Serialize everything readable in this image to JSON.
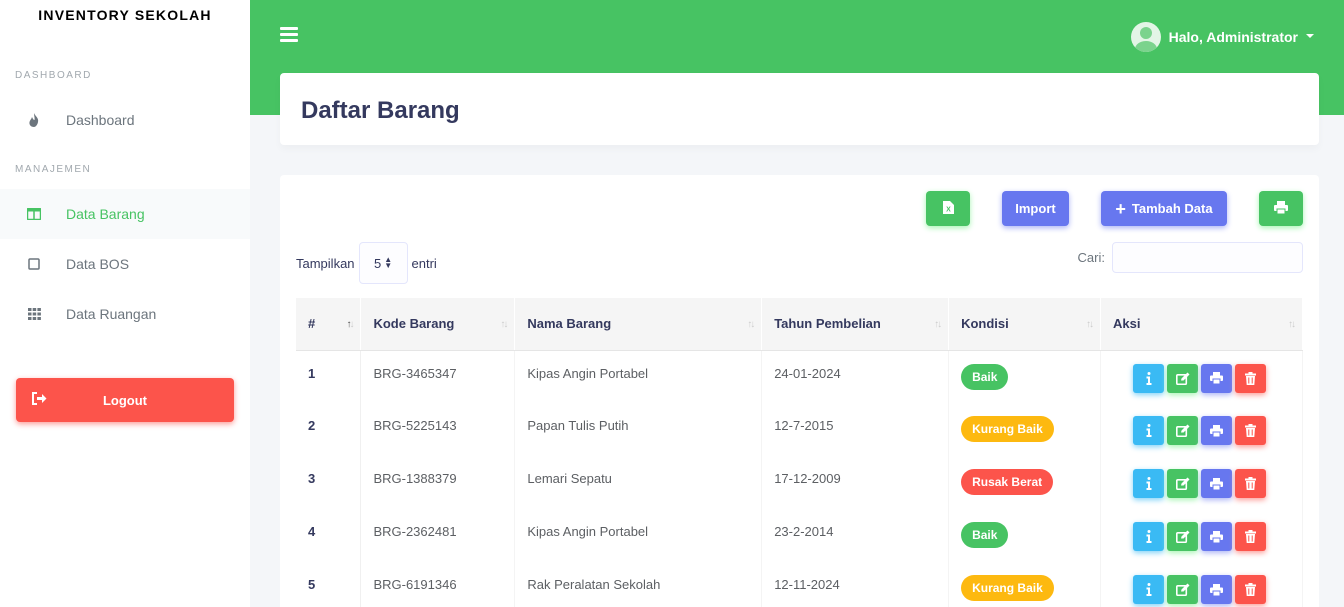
{
  "app": {
    "brand": "INVENTORY SEKOLAH"
  },
  "sidebar": {
    "headers": [
      "DASHBOARD",
      "MANAJEMEN"
    ],
    "items": [
      {
        "label": "Dashboard",
        "icon": "fire-icon",
        "active": false
      },
      {
        "label": "Data Barang",
        "icon": "columns-icon",
        "active": true
      },
      {
        "label": "Data BOS",
        "icon": "square-icon",
        "active": false
      },
      {
        "label": "Data Ruangan",
        "icon": "th-icon",
        "active": false
      }
    ],
    "logout_label": "Logout"
  },
  "topbar": {
    "greeting": "Halo, Administrator"
  },
  "page": {
    "title": "Daftar Barang"
  },
  "toolbar": {
    "import_label": "Import",
    "add_label": "Tambah Data"
  },
  "table_controls": {
    "show_prefix": "Tampilkan",
    "show_value": "5",
    "show_suffix": "entri",
    "search_label": "Cari:"
  },
  "table": {
    "columns": [
      "#",
      "Kode Barang",
      "Nama Barang",
      "Tahun Pembelian",
      "Kondisi",
      "Aksi"
    ],
    "rows": [
      {
        "no": "1",
        "kode": "BRG-3465347",
        "nama": "Kipas Angin Portabel",
        "tahun": "24-01-2024",
        "kondisi": "Baik",
        "status": "success"
      },
      {
        "no": "2",
        "kode": "BRG-5225143",
        "nama": "Papan Tulis Putih",
        "tahun": "12-7-2015",
        "kondisi": "Kurang Baik",
        "status": "warning"
      },
      {
        "no": "3",
        "kode": "BRG-1388379",
        "nama": "Lemari Sepatu",
        "tahun": "17-12-2009",
        "kondisi": "Rusak Berat",
        "status": "danger"
      },
      {
        "no": "4",
        "kode": "BRG-2362481",
        "nama": "Kipas Angin Portabel",
        "tahun": "23-2-2014",
        "kondisi": "Baik",
        "status": "success"
      },
      {
        "no": "5",
        "kode": "BRG-6191346",
        "nama": "Rak Peralatan Sekolah",
        "tahun": "12-11-2024",
        "kondisi": "Kurang Baik",
        "status": "warning"
      }
    ]
  },
  "colors": {
    "primary_green": "#47c363",
    "primary_blue": "#6777ef",
    "danger": "#fc544b",
    "warning": "#fdb910",
    "info": "#3abaf4"
  }
}
